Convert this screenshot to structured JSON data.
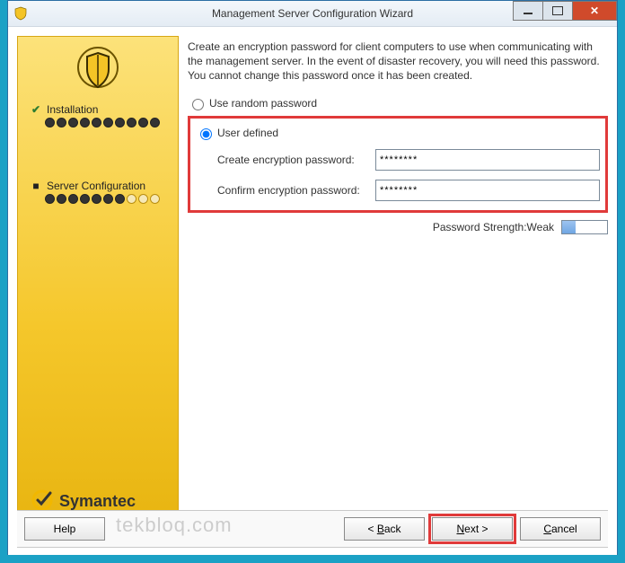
{
  "window": {
    "title": "Management Server Configuration Wizard"
  },
  "sidebar": {
    "steps": [
      {
        "label": "Installation",
        "done": true
      },
      {
        "label": "Server Configuration",
        "done": false
      }
    ]
  },
  "brand": "Symantec",
  "content": {
    "intro": "Create an encryption password for client computers to use when communicating with the management server. In the event of disaster recovery, you will need this password. You cannot change this password once it has been created.",
    "radio_random": "Use random password",
    "radio_user": "User defined",
    "create_label": "Create encryption password:",
    "confirm_label": "Confirm encryption password:",
    "pw_value": "********",
    "pw_confirm_value": "********",
    "strength_label": "Password Strength:Weak"
  },
  "buttons": {
    "help": "Help",
    "back": "< Back",
    "next": "Next >",
    "cancel": "Cancel"
  },
  "watermark": "tekbloq.com"
}
